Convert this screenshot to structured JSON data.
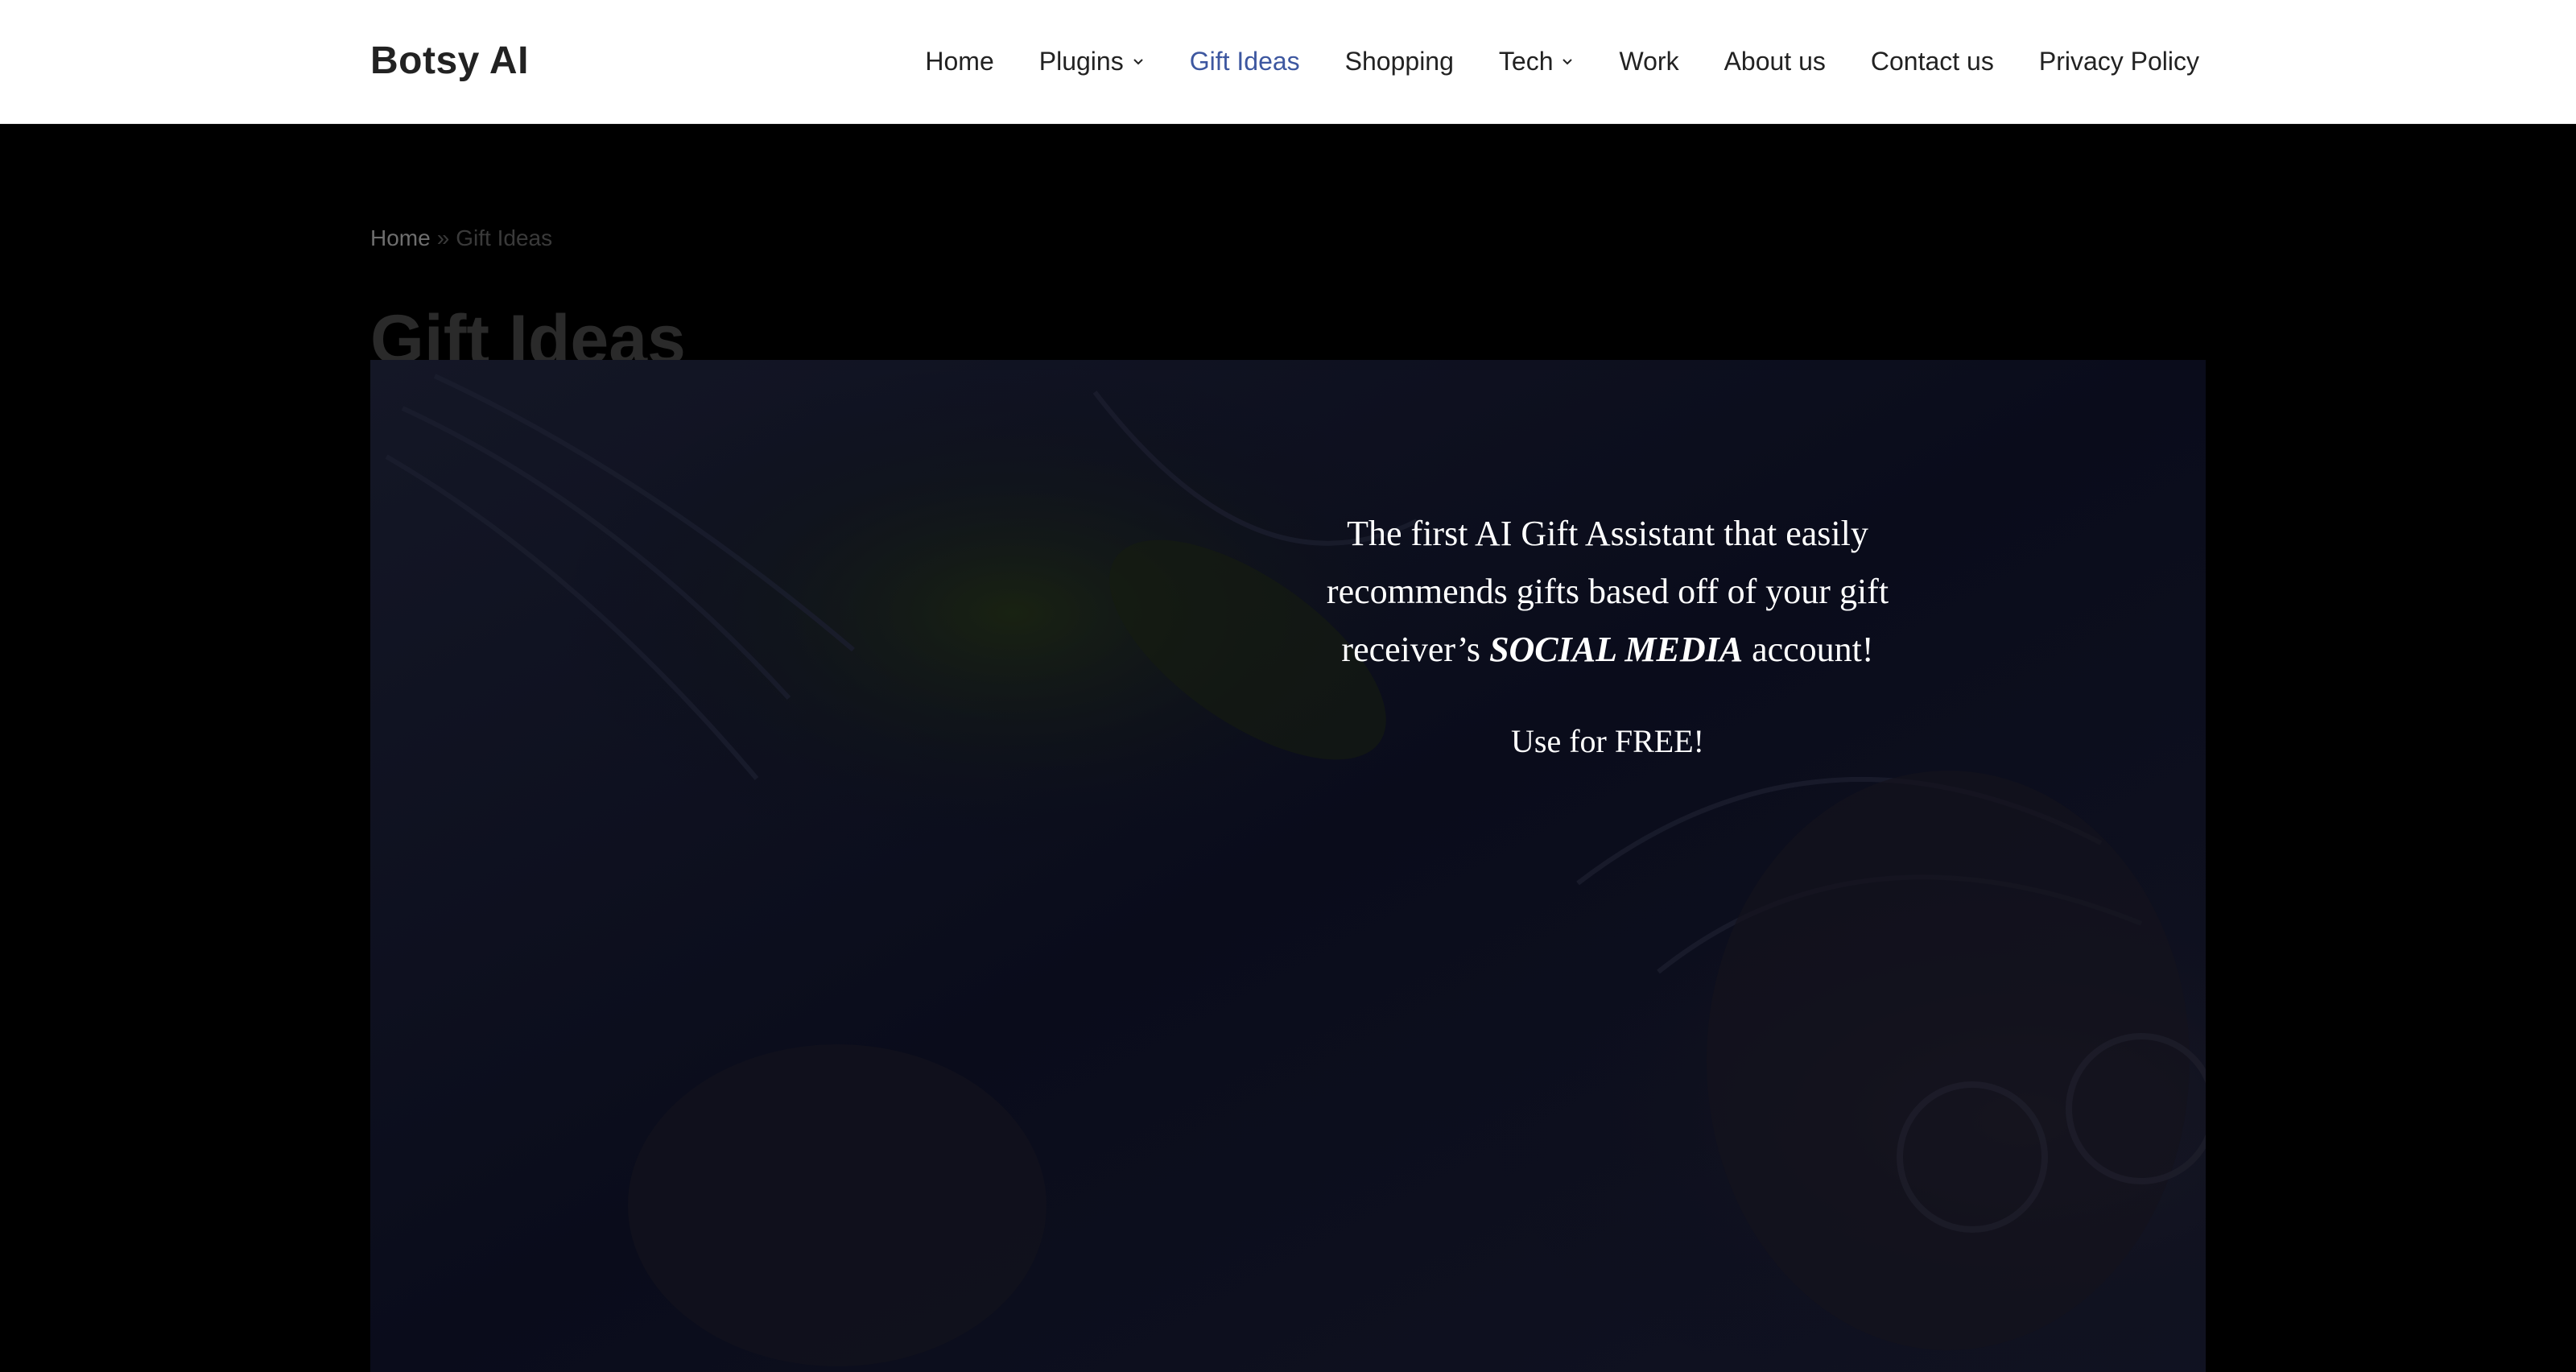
{
  "header": {
    "brand": "Botsy AI",
    "nav": [
      {
        "label": "Home",
        "has_dropdown": false,
        "active": false
      },
      {
        "label": "Plugins",
        "has_dropdown": true,
        "active": false
      },
      {
        "label": "Gift Ideas",
        "has_dropdown": false,
        "active": true
      },
      {
        "label": "Shopping",
        "has_dropdown": false,
        "active": false
      },
      {
        "label": "Tech",
        "has_dropdown": true,
        "active": false
      },
      {
        "label": "Work",
        "has_dropdown": false,
        "active": false
      },
      {
        "label": "About us",
        "has_dropdown": false,
        "active": false
      },
      {
        "label": "Contact us",
        "has_dropdown": false,
        "active": false
      },
      {
        "label": "Privacy Policy",
        "has_dropdown": false,
        "active": false
      }
    ]
  },
  "breadcrumb": {
    "home": "Home",
    "separator": "»",
    "current": "Gift Ideas"
  },
  "page": {
    "title": "Gift Ideas"
  },
  "hero": {
    "headline_before": "The first AI Gift Assistant that easily recommends gifts based off of your gift receiver’s",
    "headline_emphasis": "SOCIAL MEDIA",
    "headline_after": "account!",
    "cta": "Use for FREE!"
  },
  "colors": {
    "active_nav": "#3d57a0",
    "page_background": "#000000",
    "header_background": "#ffffff"
  }
}
